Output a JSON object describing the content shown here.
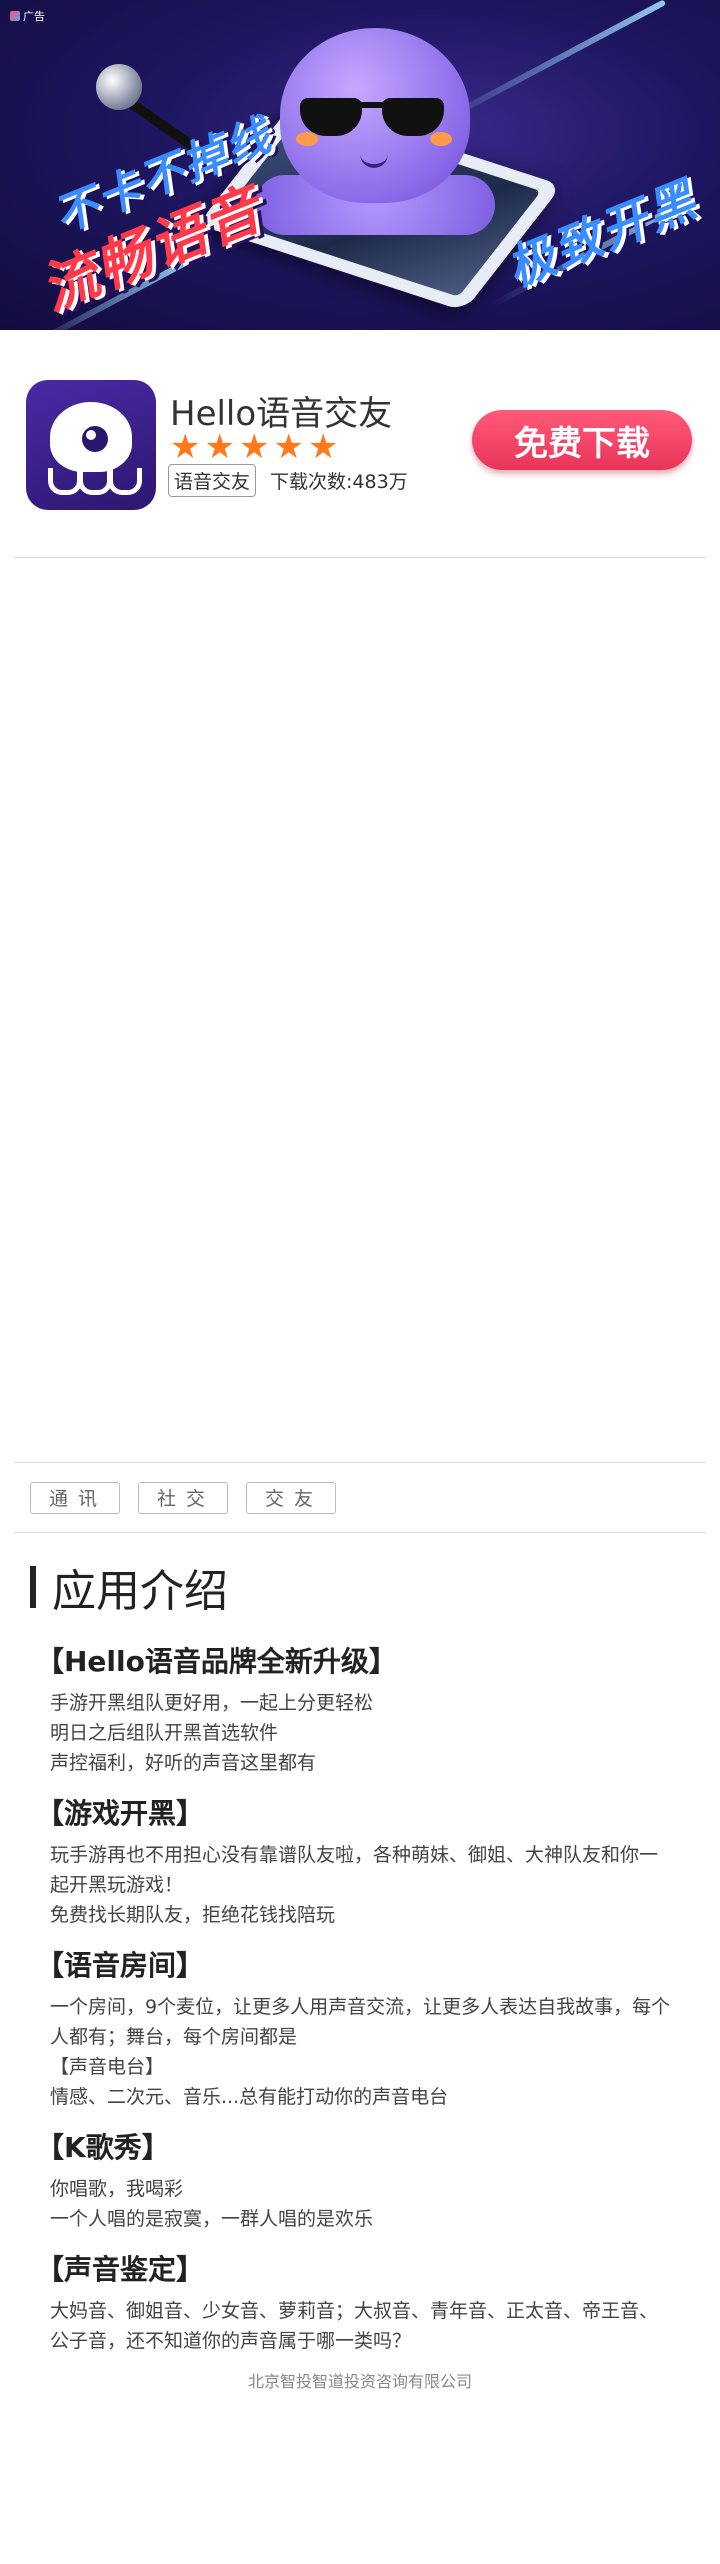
{
  "banner": {
    "ad_mark": "广告",
    "slogan_1": "不卡不掉线",
    "slogan_2": "流畅语音",
    "slogan_3": "极致开黑"
  },
  "app": {
    "name": "Hello语音交友",
    "rating_stars": 5,
    "category_tag": "语音交友",
    "downloads": "下载次数:483万",
    "download_button": "免费下载",
    "accent_color": "#e8345a",
    "star_color": "#ff7a1a"
  },
  "categories": [
    "通讯",
    "社交",
    "交友"
  ],
  "intro": {
    "title": "应用介绍",
    "sections": [
      {
        "heading": "【Hello语音品牌全新升级】",
        "lines": [
          "手游开黑组队更好用，一起上分更轻松",
          "明日之后组队开黑首选软件",
          "声控福利，好听的声音这里都有"
        ]
      },
      {
        "heading": "【游戏开黑】",
        "lines": [
          "玩手游再也不用担心没有靠谱队友啦，各种萌妹、御姐、大神队友和你一起开黑玩游戏！",
          "免费找长期队友，拒绝花钱找陪玩"
        ]
      },
      {
        "heading": "【语音房间】",
        "lines": [
          "一个房间，9个麦位，让更多人用声音交流，让更多人表达自我故事，每个人都有；舞台，每个房间都是",
          "【声音电台】",
          "情感、二次元、音乐...总有能打动你的声音电台"
        ]
      },
      {
        "heading": "【K歌秀】",
        "lines": [
          "你唱歌，我喝彩",
          "一个人唱的是寂寞，一群人唱的是欢乐"
        ]
      },
      {
        "heading": "【声音鉴定】",
        "lines": [
          "大妈音、御姐音、少女音、萝莉音；大叔音、青年音、正太音、帝王音、公子音，还不知道你的声音属于哪一类吗？"
        ]
      }
    ]
  },
  "footer": "北京智投智道投资咨询有限公司"
}
